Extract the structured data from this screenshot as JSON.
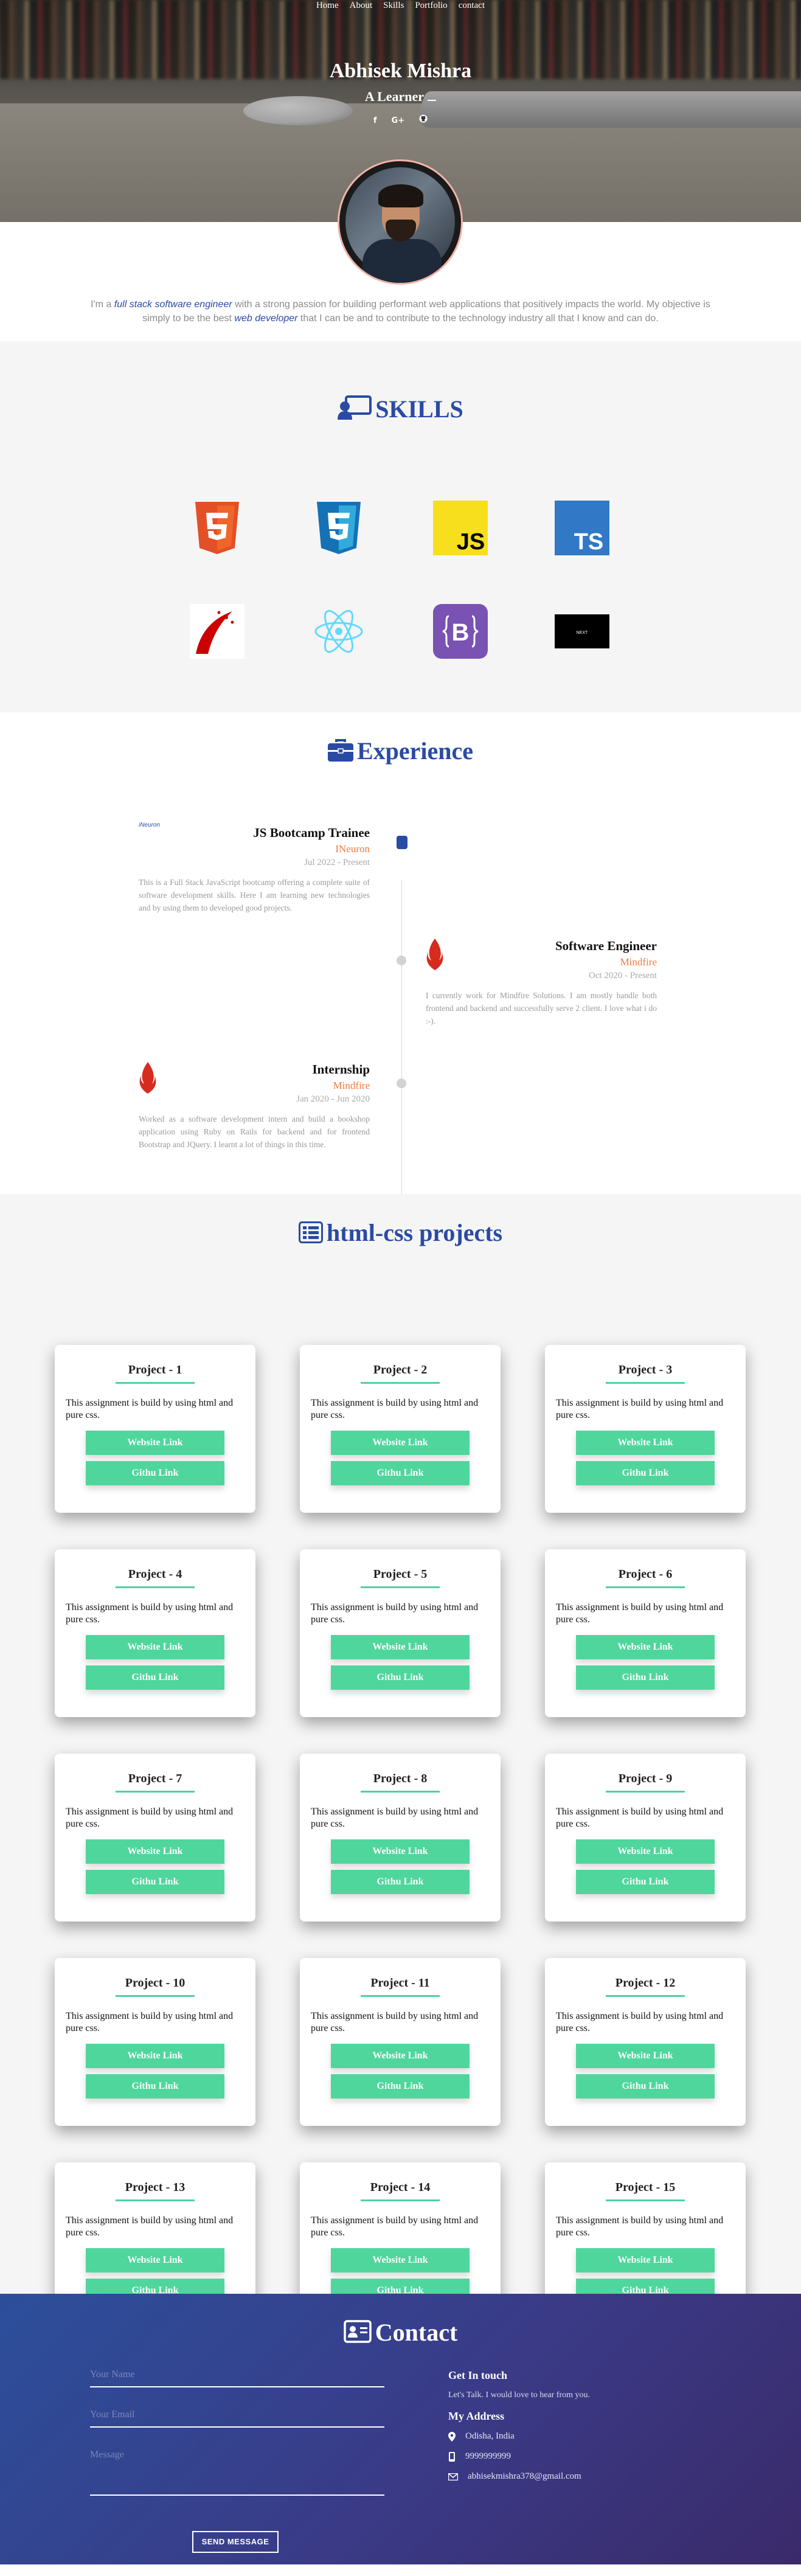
{
  "nav": {
    "items": [
      "Home",
      "About",
      "Skills",
      "Portfolio",
      "contact"
    ]
  },
  "hero": {
    "name": "Abhisek Mishra",
    "role": "A Learner",
    "socials": [
      "f",
      "G+",
      "gh"
    ]
  },
  "intro": {
    "p1": "I'm a ",
    "e1": "full stack software engineer",
    "p2": " with a strong passion for building performant web applications that positively impacts the world. My objective is simply to be the best ",
    "e2": "web developer",
    "p3": " that I can be and to contribute to the technology industry all that I know and can do."
  },
  "skills": {
    "title": "SKILLS",
    "items": [
      "html5-icon",
      "css3-icon",
      "js-icon",
      "ts-icon",
      "rails-icon",
      "react-icon",
      "bootstrap-icon",
      "nextjs-icon"
    ],
    "ts_label": "TS",
    "js_label": "JS",
    "bs_label": "B",
    "next_label": "NEXT"
  },
  "experience": {
    "title": "Experience",
    "items": [
      {
        "logo_text": "iNeuron",
        "role": "JS Bootcamp Trainee",
        "company": "INeuron",
        "date": "Jul 2022 - Present",
        "desc": "This is a Full Stack JavaScript bootcamp offering a complete suite of software development skills. Here I am learning new technologies and by using them to developed good projects."
      },
      {
        "role": "Software Engineer",
        "company": "Mindfire",
        "date": "Oct 2020 - Present",
        "desc": "I currently work for Mindfire Solutions. I am mostly handle both frontend and backend and successfully serve 2 client. I love what i do :-)."
      },
      {
        "role": "Internship",
        "company": "Mindfire",
        "date": "Jan 2020 - Jun 2020",
        "desc": "Worked as a software development intern and build a bookshop application using Ruby on Rails for backend and for frontend Bootstrap and JQuery. I learnt a lot of things in this time."
      }
    ]
  },
  "projects": {
    "title": "html-css projects",
    "description": "This assignment is build by using html and pure css.",
    "website_label": "Website Link",
    "github_label": "Githu Link",
    "items": [
      "Project - 1",
      "Project - 2",
      "Project - 3",
      "Project - 4",
      "Project - 5",
      "Project - 6",
      "Project - 7",
      "Project - 8",
      "Project - 9",
      "Project - 10",
      "Project - 11",
      "Project - 12",
      "Project - 13",
      "Project - 14",
      "Project - 15"
    ]
  },
  "contact": {
    "title": "Contact",
    "name_placeholder": "Your Name",
    "email_placeholder": "Your Email",
    "message_placeholder": "Message",
    "send_label": "SEND MESSAGE",
    "get_in_touch": "Get In touch",
    "tagline": "Let's Talk. I would love to hear from you.",
    "address_heading": "My Address",
    "location": "Odisha, India",
    "phone": "9999999999",
    "email": "abhisekmishra378@gmail.com"
  },
  "colors": {
    "accent": "#2a4ba3",
    "orange": "#f07b3f",
    "green": "#4fd69c"
  }
}
